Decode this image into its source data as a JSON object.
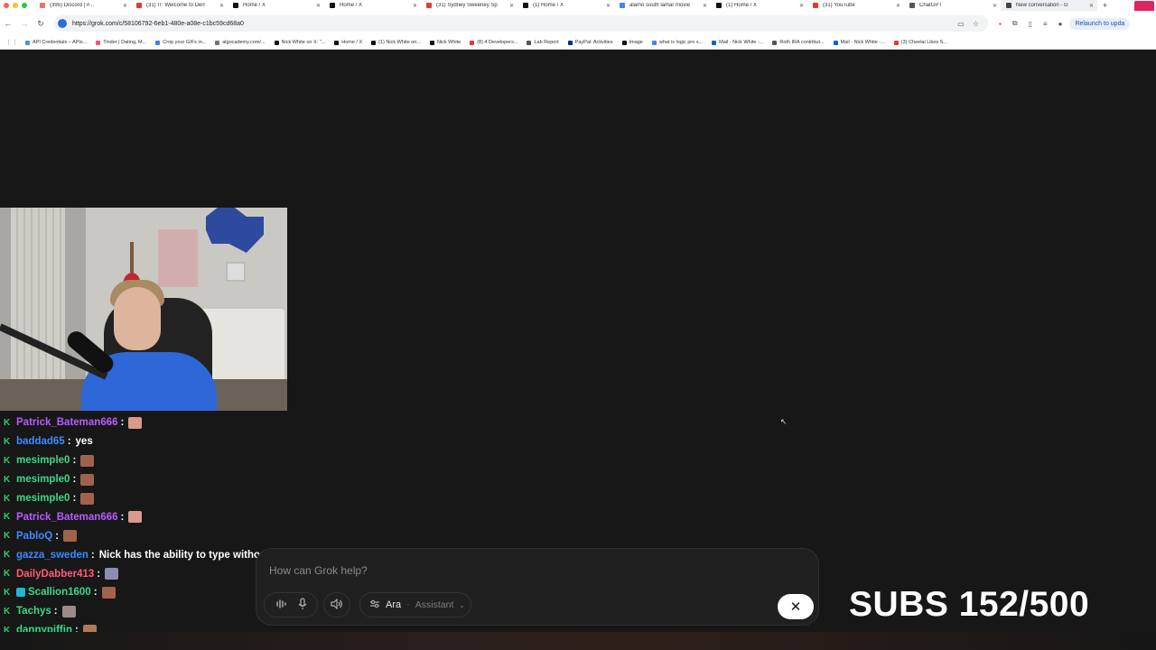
{
  "browser": {
    "tabs": [
      {
        "title": "(395) Discord | #...",
        "color": "#e57373"
      },
      {
        "title": "(31) IT: Welcome to Derr",
        "color": "#e53935"
      },
      {
        "title": "Home / X",
        "color": "#111111"
      },
      {
        "title": "Home / X",
        "color": "#111111"
      },
      {
        "title": "(31) Sydney Sweeney Sp",
        "color": "#e53935"
      },
      {
        "title": "(1) Home / X",
        "color": "#111111"
      },
      {
        "title": "alamo south lamar movie",
        "color": "#4285f4"
      },
      {
        "title": "(1) Home / X",
        "color": "#111111"
      },
      {
        "title": "(31) YouTube",
        "color": "#e53935"
      },
      {
        "title": "ChatGPT",
        "color": "#555555"
      },
      {
        "title": "New conversation - G",
        "color": "#444444"
      }
    ],
    "new_tab_label": "+",
    "url": "https://grok.com/c/58106792-6eb1-480e-a08e-c1bc59cd68a0",
    "relaunch_label": "Relaunch to upda",
    "bookmarks": [
      {
        "label": "API Credentials – APIs...",
        "color": "#4a90d9"
      },
      {
        "label": "Tinder | Dating, M...",
        "color": "#fd5068"
      },
      {
        "label": "Crop your GIFs in...",
        "color": "#3b82f6"
      },
      {
        "label": "algocademy.com/...",
        "color": "#6b7280"
      },
      {
        "label": "Nick White on X: \"...",
        "color": "#111111"
      },
      {
        "label": "Home / X",
        "color": "#111111"
      },
      {
        "label": "(1) Nick White on...",
        "color": "#111111"
      },
      {
        "label": "Nick White",
        "color": "#111111"
      },
      {
        "label": "(8) 4 Developers...",
        "color": "#e53935"
      },
      {
        "label": "Lab Report",
        "color": "#555555"
      },
      {
        "label": "PayPal: Activities",
        "color": "#003087"
      },
      {
        "label": "Image",
        "color": "#111111"
      },
      {
        "label": "what is logic pro x...",
        "color": "#4285f4"
      },
      {
        "label": "Mail - Nick White -...",
        "color": "#0a66c2"
      },
      {
        "label": "Roth IRA contribut...",
        "color": "#555555"
      },
      {
        "label": "Mail - Nick White -...",
        "color": "#0a66c2"
      },
      {
        "label": "(3) Cheelai Likes S...",
        "color": "#e53935"
      }
    ]
  },
  "chat": [
    {
      "user": "Patrick_Bateman666",
      "color": "#b65cff",
      "message": "",
      "emote": "#d99a8a"
    },
    {
      "user": "baddad65",
      "color": "#3c8cff",
      "message": "yes",
      "emote": ""
    },
    {
      "user": "mesimple0",
      "color": "#39d98a",
      "message": "",
      "emote": "#a0624d"
    },
    {
      "user": "mesimple0",
      "color": "#39d98a",
      "message": "",
      "emote": "#a0624d"
    },
    {
      "user": "mesimple0",
      "color": "#39d98a",
      "message": "",
      "emote": "#a0624d"
    },
    {
      "user": "Patrick_Bateman666",
      "color": "#b65cff",
      "message": "",
      "emote": "#d99a8a"
    },
    {
      "user": "PabloQ",
      "color": "#3c8cff",
      "message": "",
      "emote": "#a0624d"
    },
    {
      "user": "gazza_sweden",
      "color": "#3c8cff",
      "message": "Nick has the ability to type without looking away from chat.",
      "emote": ""
    },
    {
      "user": "DailyDabber413",
      "color": "#ff5a7a",
      "message": "",
      "emote": "#8c8cb4"
    },
    {
      "user": "Scallion1600",
      "color": "#39d98a",
      "message": "",
      "emote": "#a0624d"
    },
    {
      "user": "Tachys",
      "color": "#39d98a",
      "message": "",
      "emote": "#9a8a8a"
    },
    {
      "user": "dannypiffin",
      "color": "#39d98a",
      "message": "",
      "emote": "#b07a5a"
    }
  ],
  "grok": {
    "placeholder": "How can Grok help?",
    "persona_name": "Ara",
    "persona_separator": "·",
    "persona_role": "Assistant",
    "close_label": "✕"
  },
  "overlay": {
    "subs_text": "SUBS 152/500"
  }
}
